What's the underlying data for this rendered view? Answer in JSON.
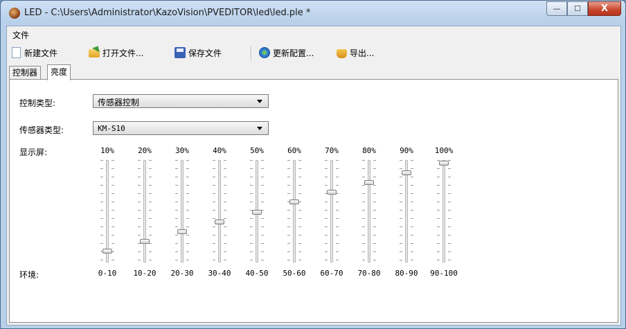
{
  "window": {
    "title": "LED - C:\\Users\\Administrator\\KazoVision\\PVEDITOR\\led\\led.ple *",
    "min_symbol": "—",
    "max_symbol": "☐",
    "close_symbol": "X"
  },
  "menu": {
    "file": "文件"
  },
  "toolbar": {
    "new_file": "新建文件",
    "open_file": "打开文件...",
    "save_file": "保存文件",
    "update_config": "更新配置...",
    "export": "导出..."
  },
  "tabs": [
    {
      "label": "控制器",
      "active": false
    },
    {
      "label": "亮度",
      "active": true
    }
  ],
  "form": {
    "control_type_label": "控制类型:",
    "control_type_value": "传感器控制",
    "sensor_type_label": "传感器类型:",
    "sensor_type_value": "KM-S10",
    "display_label": "显示屏:",
    "env_label": "环境:"
  },
  "brightness": {
    "levels": [
      "10%",
      "20%",
      "30%",
      "40%",
      "50%",
      "60%",
      "70%",
      "80%",
      "90%",
      "100%"
    ],
    "ranges": [
      "0-10",
      "10-20",
      "20-30",
      "30-40",
      "40-50",
      "50-60",
      "60-70",
      "70-80",
      "80-90",
      "90-100"
    ],
    "slider_values": [
      0.1,
      0.2,
      0.3,
      0.4,
      0.5,
      0.6,
      0.7,
      0.8,
      0.9,
      1.0
    ]
  }
}
